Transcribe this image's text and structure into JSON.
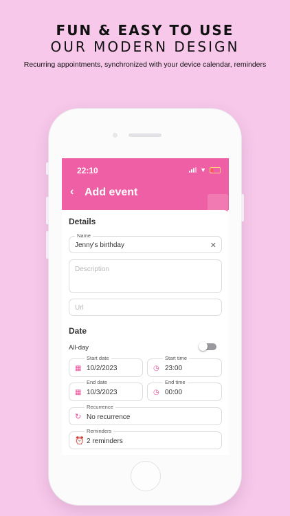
{
  "header": {
    "line1": "FUN & EASY TO USE",
    "line2": "OUR MODERN DESIGN",
    "subtitle": "Recurring appointments, synchronized with your device calendar, reminders"
  },
  "status_bar": {
    "time": "22:10"
  },
  "appbar": {
    "title": "Add event",
    "back_icon": "chevron-left-icon"
  },
  "details": {
    "section_title": "Details",
    "name": {
      "label": "Name",
      "value": "Jenny's birthday"
    },
    "description": {
      "placeholder": "Description"
    },
    "url": {
      "placeholder": "Url"
    }
  },
  "date": {
    "section_title": "Date",
    "allday_label": "All-day",
    "allday_on": false,
    "start_date": {
      "label": "Start date",
      "value": "10/2/2023"
    },
    "start_time": {
      "label": "Start time",
      "value": "23:00"
    },
    "end_date": {
      "label": "End date",
      "value": "10/3/2023"
    },
    "end_time": {
      "label": "End time",
      "value": "00:00"
    },
    "recurrence": {
      "label": "Recurrence",
      "value": "No recurrence"
    },
    "reminders": {
      "label": "Reminders",
      "value": "2 reminders"
    }
  },
  "colors": {
    "background": "#f7c8ea",
    "accent": "#ee5fa5",
    "icon": "#e94f99"
  }
}
